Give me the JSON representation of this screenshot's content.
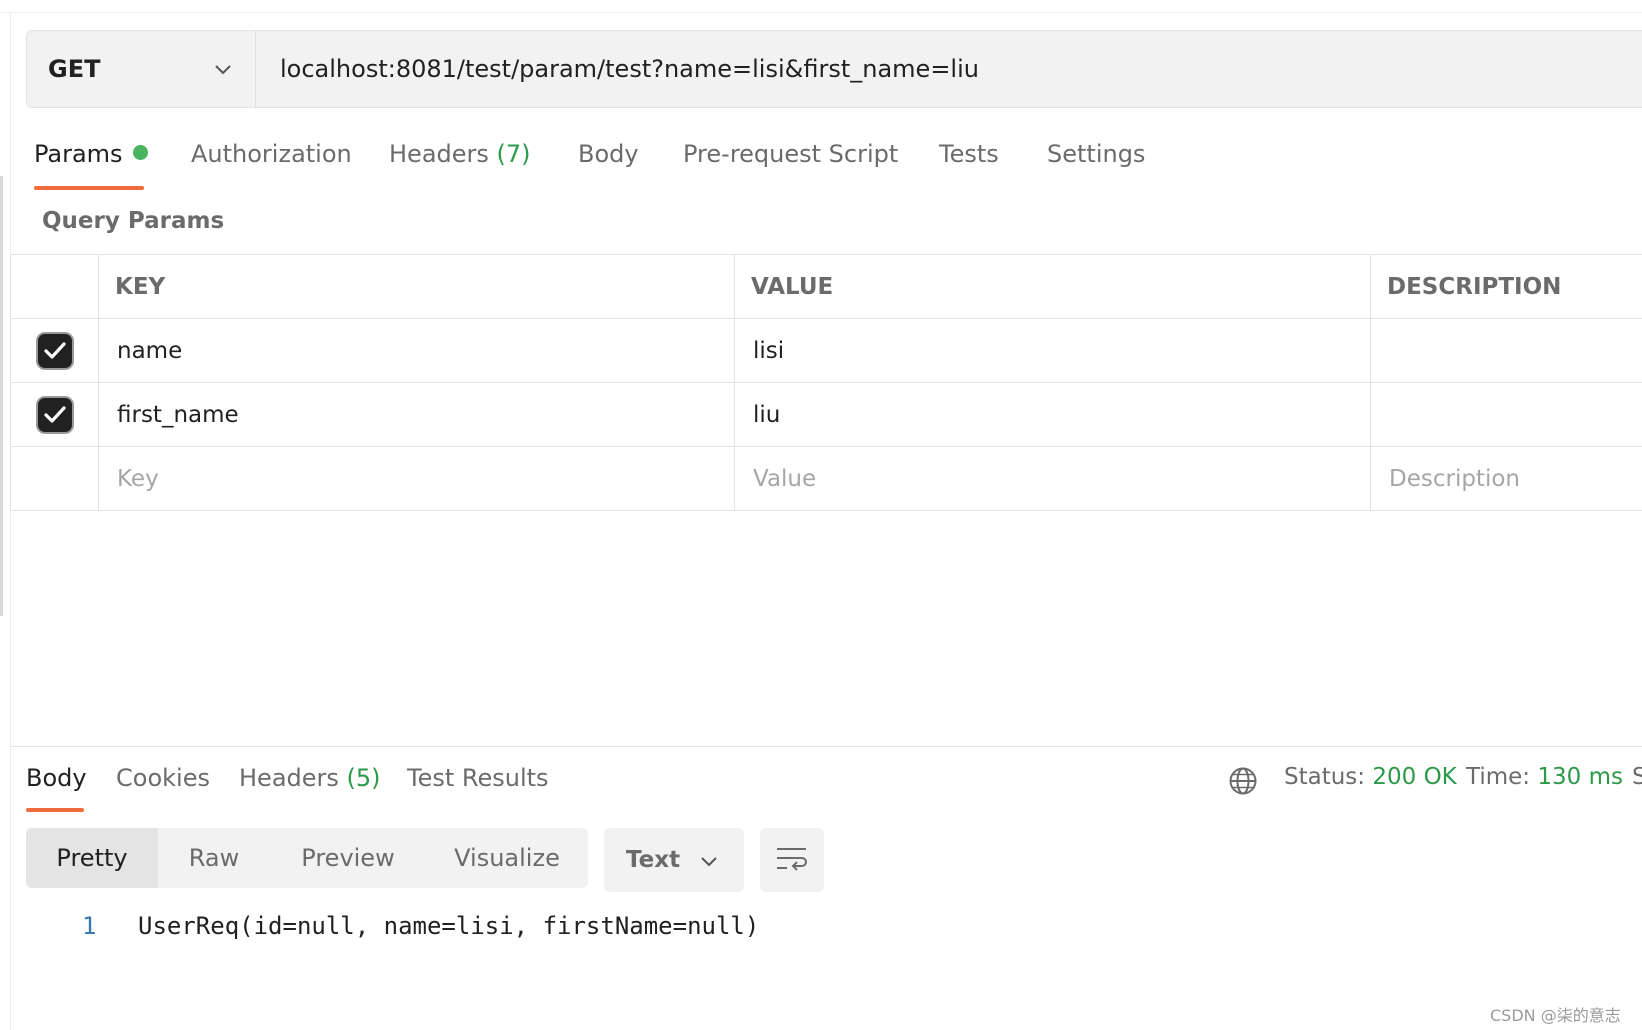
{
  "request": {
    "method": "GET",
    "url": "localhost:8081/test/param/test?name=lisi&first_name=liu"
  },
  "request_tabs": [
    {
      "label": "Params",
      "count": ""
    },
    {
      "label": "Authorization",
      "count": ""
    },
    {
      "label": "Headers",
      "count": "(7)"
    },
    {
      "label": "Body",
      "count": ""
    },
    {
      "label": "Pre-request Script",
      "count": ""
    },
    {
      "label": "Tests",
      "count": ""
    },
    {
      "label": "Settings",
      "count": ""
    }
  ],
  "query_params": {
    "title": "Query Params",
    "headers": [
      "KEY",
      "VALUE",
      "DESCRIPTION"
    ],
    "rows": [
      {
        "checked": true,
        "key": "name",
        "value": "lisi",
        "description": ""
      },
      {
        "checked": true,
        "key": "first_name",
        "value": "liu",
        "description": ""
      }
    ],
    "placeholders": {
      "key": "Key",
      "value": "Value",
      "description": "Description"
    }
  },
  "response_tabs": [
    {
      "label": "Body",
      "count": ""
    },
    {
      "label": "Cookies",
      "count": ""
    },
    {
      "label": "Headers",
      "count": "(5)"
    },
    {
      "label": "Test Results",
      "count": ""
    }
  ],
  "response_status": {
    "status_label": "Status:",
    "status_value": "200 OK",
    "time_label": "Time:",
    "time_value": "130 ms",
    "size_label_fragment": "S"
  },
  "response_formats": [
    "Pretty",
    "Raw",
    "Preview",
    "Visualize"
  ],
  "response_language": "Text",
  "response_body": {
    "line_number": "1",
    "code": "UserReq(id=null, name=lisi, firstName=null)"
  },
  "watermark": "CSDN @柒的意志",
  "colors": {
    "accent": "#f26b3a",
    "success": "#2c9a48",
    "dot": "#49b35e"
  },
  "icons": [
    "chevron-down-icon",
    "checkbox-checked-icon",
    "globe-icon",
    "wrap-lines-icon"
  ]
}
